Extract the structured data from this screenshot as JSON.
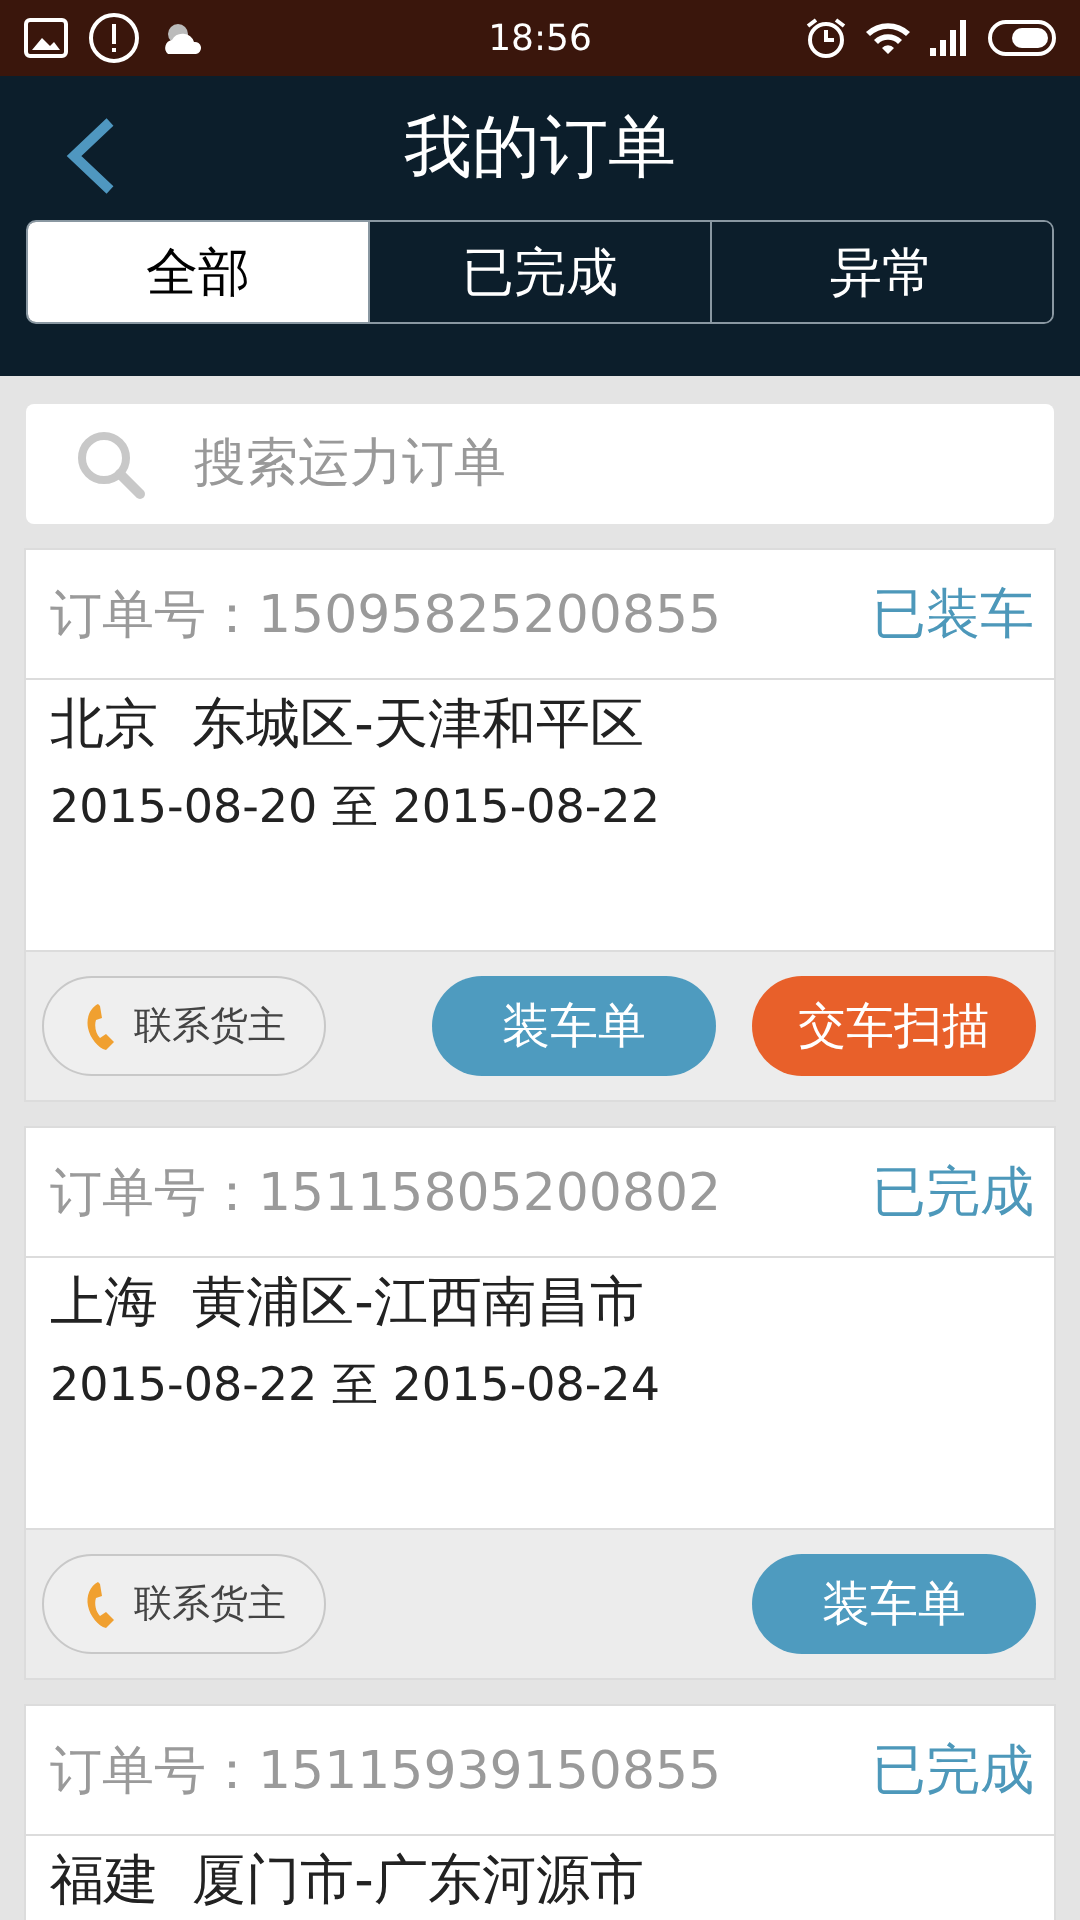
{
  "status_bar": {
    "time": "18:56"
  },
  "header": {
    "title": "我的订单"
  },
  "tabs": [
    {
      "label": "全部",
      "selected": true
    },
    {
      "label": "已完成",
      "selected": false
    },
    {
      "label": "异常",
      "selected": false
    }
  ],
  "search": {
    "placeholder": "搜索运力订单"
  },
  "orders": [
    {
      "order_no": "订单号：15095825200855",
      "status": "已装车",
      "route": "北京  东城区-天津和平区",
      "dates": "2015-08-20 至 2015-08-22",
      "buttons": [
        {
          "label": "联系货主",
          "kind": "contact"
        },
        {
          "label": "装车单",
          "kind": "primary"
        },
        {
          "label": "交车扫描",
          "kind": "accent"
        }
      ]
    },
    {
      "order_no": "订单号：15115805200802",
      "status": "已完成",
      "route": "上海  黄浦区-江西南昌市",
      "dates": "2015-08-22 至 2015-08-24",
      "buttons": [
        {
          "label": "联系货主",
          "kind": "contact"
        },
        {
          "label": "装车单",
          "kind": "primary"
        }
      ]
    },
    {
      "order_no": "订单号：15115939150855",
      "status": "已完成",
      "route": "福建  厦门市-广东河源市"
    }
  ]
}
